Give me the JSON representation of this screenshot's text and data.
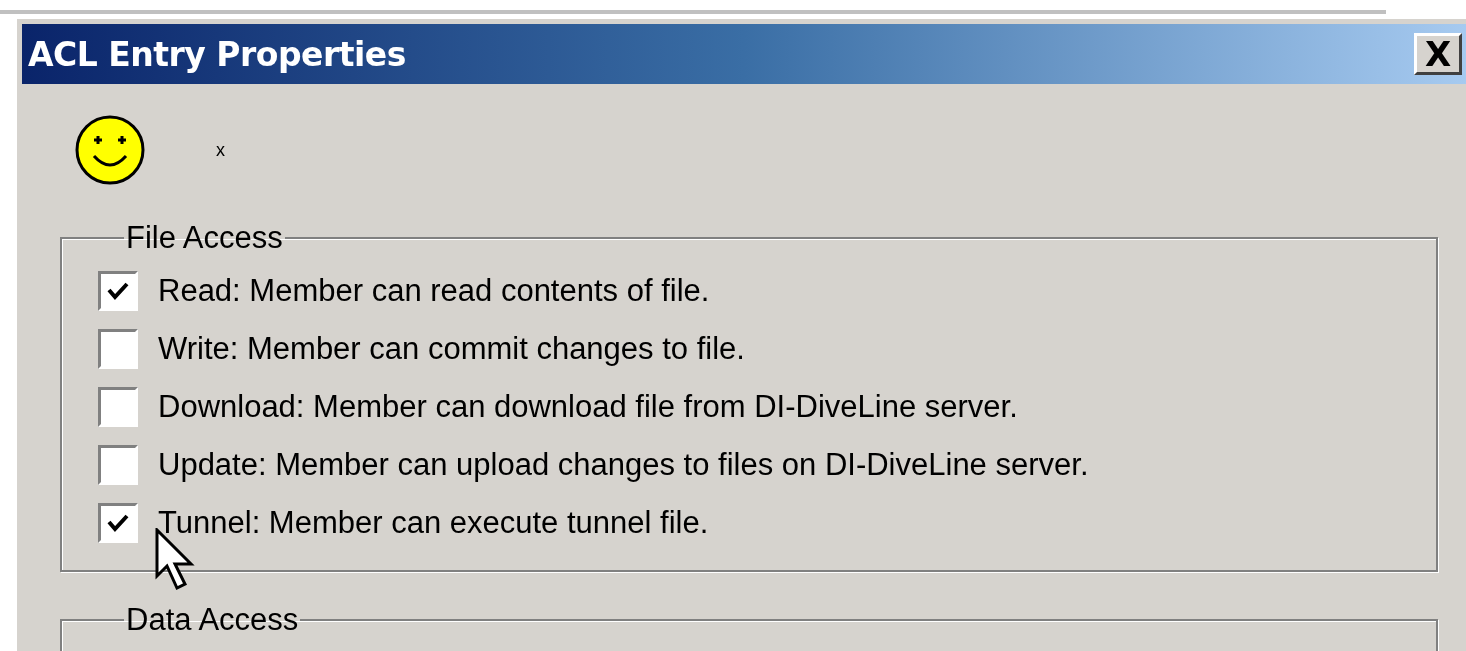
{
  "window": {
    "title": "ACL Entry Properties",
    "close": "X"
  },
  "member": {
    "name": "x"
  },
  "groups": [
    {
      "title": "File Access",
      "options": [
        {
          "label": "Read: Member can read contents of file.",
          "checked": true
        },
        {
          "label": "Write: Member can commit changes to file.",
          "checked": false
        },
        {
          "label": "Download: Member can download file from DI-DiveLine server.",
          "checked": false
        },
        {
          "label": "Update: Member can upload changes to files on DI-DiveLine server.",
          "checked": false
        },
        {
          "label": "Tunnel: Member can execute tunnel file.",
          "checked": true
        }
      ]
    },
    {
      "title": "Data Access"
    }
  ]
}
